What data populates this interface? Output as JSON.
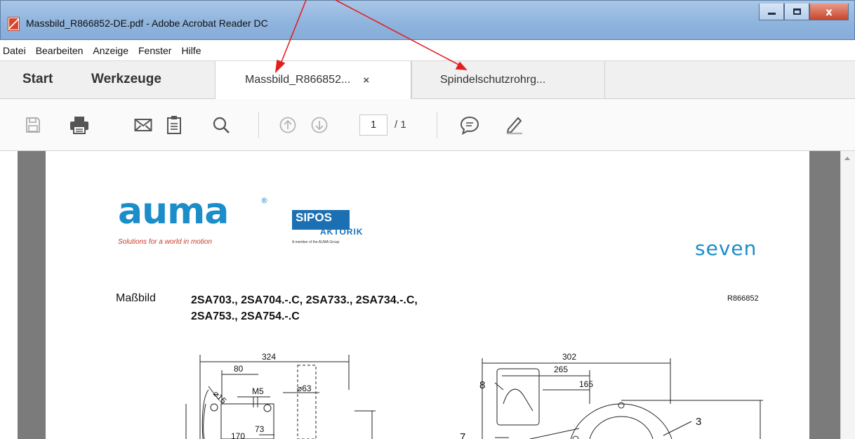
{
  "window": {
    "title": "Massbild_R866852-DE.pdf - Adobe Acrobat Reader DC",
    "close_label": "x"
  },
  "menu": [
    "Datei",
    "Bearbeiten",
    "Anzeige",
    "Fenster",
    "Hilfe"
  ],
  "tabs": {
    "start": "Start",
    "tools": "Werkzeuge",
    "documents": [
      {
        "label": "Massbild_R866852...",
        "close": "×"
      },
      {
        "label": "Spindelschutzrohrg..."
      }
    ]
  },
  "toolbar": {
    "page_current": "1",
    "page_total": "/ 1"
  },
  "page": {
    "brand": "auma",
    "brand_reg": "®",
    "brand_tagline": "Solutions for a world in motion",
    "partner_name": "SIPOS",
    "partner_sub": "AKTORIK",
    "partner_note": "A member of the AUMA Group",
    "product": "seven",
    "heading_label": "Maßbild",
    "heading_line1": "2SA703., 2SA704.-.C, 2SA733., 2SA734.-.C,",
    "heading_line2": "2SA753., 2SA754.-.C",
    "reference": "R866852",
    "dims": {
      "d324": "324",
      "d80": "80",
      "d63": "⌀63",
      "m5": "M5",
      "d15": "⌀15",
      "d73": "73",
      "d170": "170",
      "d302": "302",
      "d265": "265",
      "d165": "165",
      "c8": "8",
      "c7": "7",
      "c3": "3"
    }
  },
  "colors": {
    "annotation_arrow": "#e21f1f",
    "brand_blue": "#1b8dc8",
    "partner_blue": "#1b6fb3",
    "tagline_red": "#c63b2b"
  }
}
